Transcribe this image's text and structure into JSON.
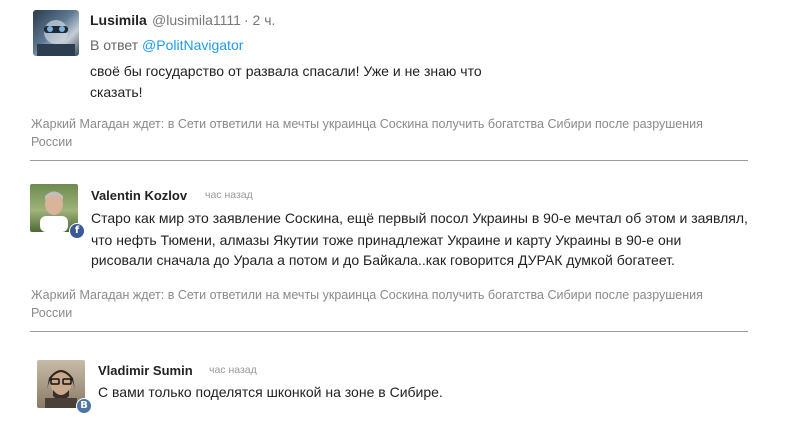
{
  "comments": [
    {
      "author": "Lusimila",
      "handle": "@lusimila1111",
      "time": "· 2 ч.",
      "reply_prefix": "В ответ",
      "reply_to": "@PolitNavigator",
      "text_lines": [
        "своё бы государство от развала спасали! Уже и не знаю что",
        "сказать!"
      ],
      "source_lines": [
        "Жаркий Магадан ждет: в Сети ответили на мечты украинца Соскина получить богатства Сибири после разрушения",
        "России"
      ]
    },
    {
      "author": "Valentin Kozlov",
      "time": "час назад",
      "network_badge": "f",
      "text_lines": [
        "Старо как мир это заявление Соскина, ещё первый посол Украины в 90-е мечтал об этом и заявлял,",
        "что нефть Тюмени, алмазы Якутии  тоже принадлежат Украине  и карту Украины в 90-е они",
        "рисовали сначала до Урала а потом и до Байкала..как говорится ДУРАК думкой богатеет."
      ],
      "source_lines": [
        "Жаркий Магадан ждет: в Сети ответили на мечты украинца Соскина получить богатства Сибири после разрушения",
        "России"
      ]
    },
    {
      "author": "Vladimir Sumin",
      "time": "час назад",
      "network_badge": "B",
      "text_lines": [
        "С вами только поделятся шконкой на зоне в Сибире."
      ]
    }
  ],
  "colors": {
    "link": "#1d9bf0",
    "muted": "#8a8a8a",
    "facebook": "#3b5998",
    "vk": "#4c75a3"
  }
}
